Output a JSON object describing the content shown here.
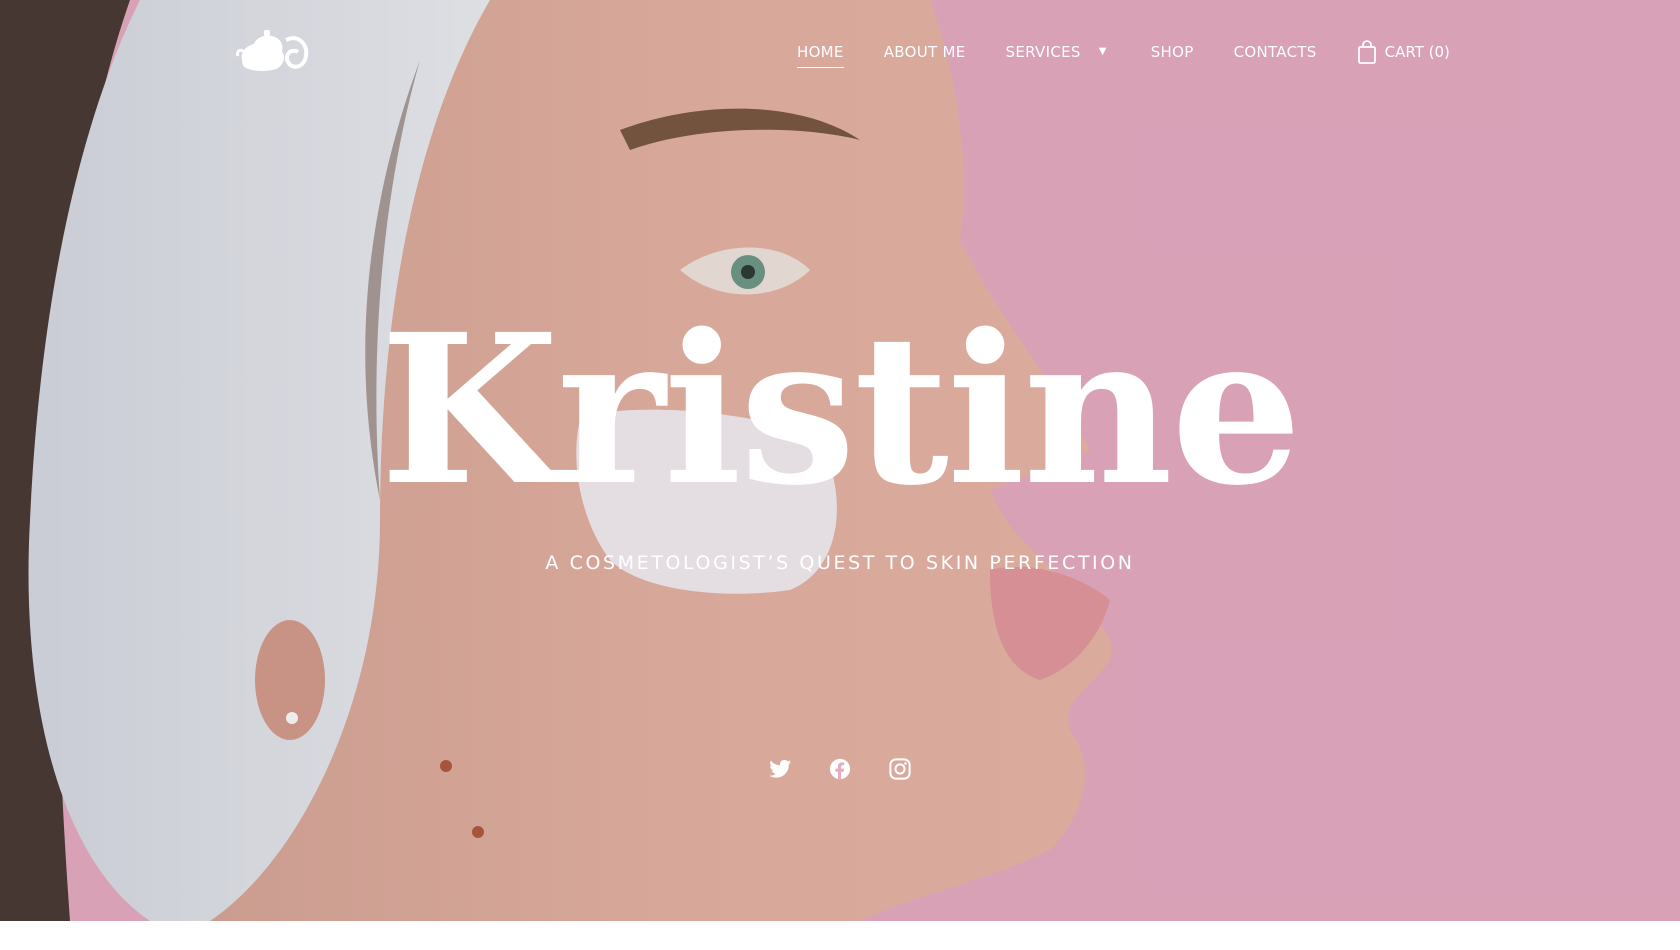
{
  "nav": {
    "items": [
      {
        "label": "HOME",
        "active": true
      },
      {
        "label": "ABOUT ME",
        "active": false
      },
      {
        "label": "SERVICES",
        "active": false,
        "has_dropdown": true
      },
      {
        "label": "SHOP",
        "active": false
      },
      {
        "label": "CONTACTS",
        "active": false
      }
    ],
    "cart_label": "CART (0)",
    "cart_icon": "shopping-bag-icon",
    "dropdown_icon": "caret-down-icon"
  },
  "logo": {
    "icon": "teapot-logo-icon"
  },
  "hero": {
    "title": "Kristine",
    "subtitle": "A COSMETOLOGIST’S QUEST TO SKIN PERFECTION"
  },
  "social": [
    {
      "icon": "twitter-icon"
    },
    {
      "icon": "facebook-icon"
    },
    {
      "icon": "instagram-icon"
    }
  ],
  "colors": {
    "background_pink": "#e8adc4",
    "text": "#ffffff"
  }
}
